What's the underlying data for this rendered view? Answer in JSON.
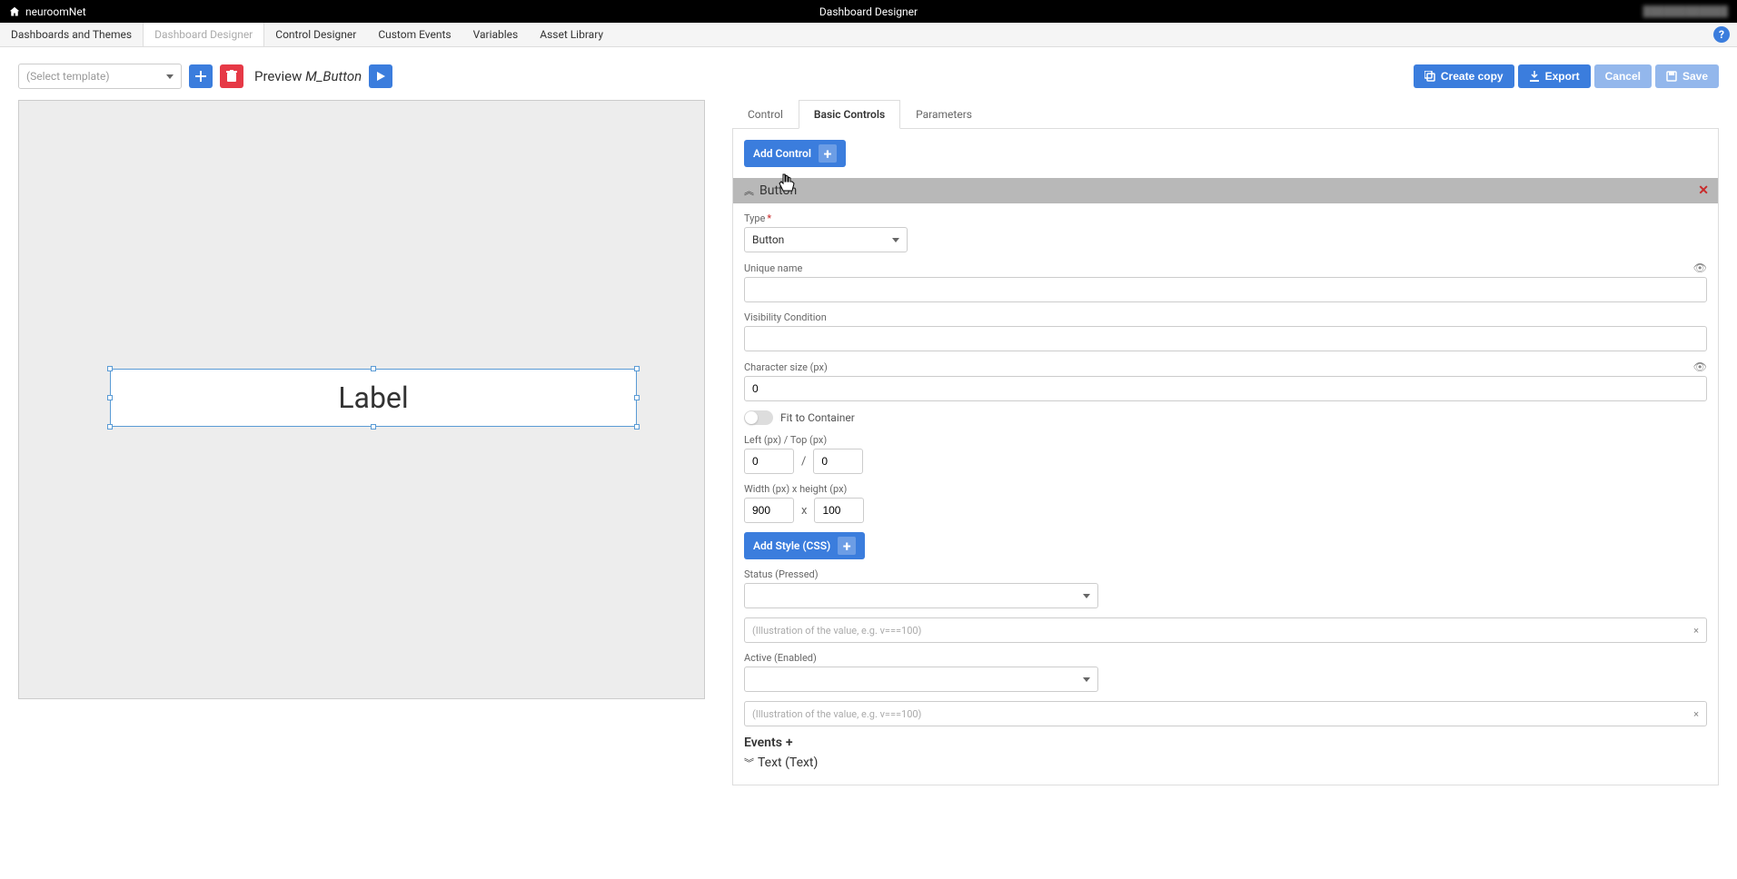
{
  "topbar": {
    "brand": "neuroomNet",
    "title": "Dashboard Designer",
    "user": "████████████"
  },
  "navTabs": {
    "items": [
      "Dashboards and Themes",
      "Dashboard Designer",
      "Control Designer",
      "Custom Events",
      "Variables",
      "Asset Library"
    ]
  },
  "toolbar": {
    "templatePlaceholder": "(Select template)",
    "preview": "Preview",
    "previewName": "M_Button",
    "createCopy": "Create copy",
    "export": "Export",
    "cancel": "Cancel",
    "save": "Save"
  },
  "canvas": {
    "elementLabel": "Label"
  },
  "panel": {
    "tabs": {
      "control": "Control",
      "basic": "Basic Controls",
      "params": "Parameters"
    },
    "addControl": "Add Control",
    "section": {
      "title": "Button",
      "typeLabel": "Type",
      "typeValue": "Button",
      "uniqueName": "Unique name",
      "visibility": "Visibility Condition",
      "charSize": "Character size (px)",
      "charSizeValue": "0",
      "fitContainer": "Fit to Container",
      "leftTop": "Left (px) / Top (px)",
      "leftVal": "0",
      "topVal": "0",
      "widthHeight": "Width (px) x height (px)",
      "widthVal": "900",
      "heightVal": "100",
      "addStyle": "Add Style (CSS)",
      "statusPressed": "Status (Pressed)",
      "activeEnabled": "Active (Enabled)",
      "illustrationPlaceholder": "(Illustration of the value, e.g. v===100)",
      "events": "Events",
      "textSection": "Text (Text)"
    }
  }
}
